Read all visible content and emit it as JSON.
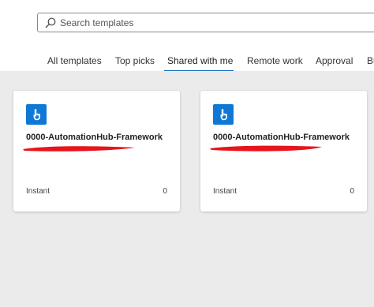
{
  "search": {
    "placeholder": "Search templates"
  },
  "tabs": [
    {
      "label": "All templates"
    },
    {
      "label": "Top picks"
    },
    {
      "label": "Shared with me",
      "active": true
    },
    {
      "label": "Remote work"
    },
    {
      "label": "Approval"
    },
    {
      "label": "Bu"
    }
  ],
  "cards": [
    {
      "icon": "touch-tap-icon",
      "title": "0000-AutomationHub-Framework",
      "type": "Instant",
      "count": "0"
    },
    {
      "icon": "touch-tap-icon",
      "title": "0000-AutomationHub-Framework",
      "type": "Instant",
      "count": "0"
    }
  ],
  "colors": {
    "accent": "#0f6cbd",
    "icon_tile": "#0f78d4",
    "redaction": "#e8141b",
    "background": "#ebebeb"
  }
}
